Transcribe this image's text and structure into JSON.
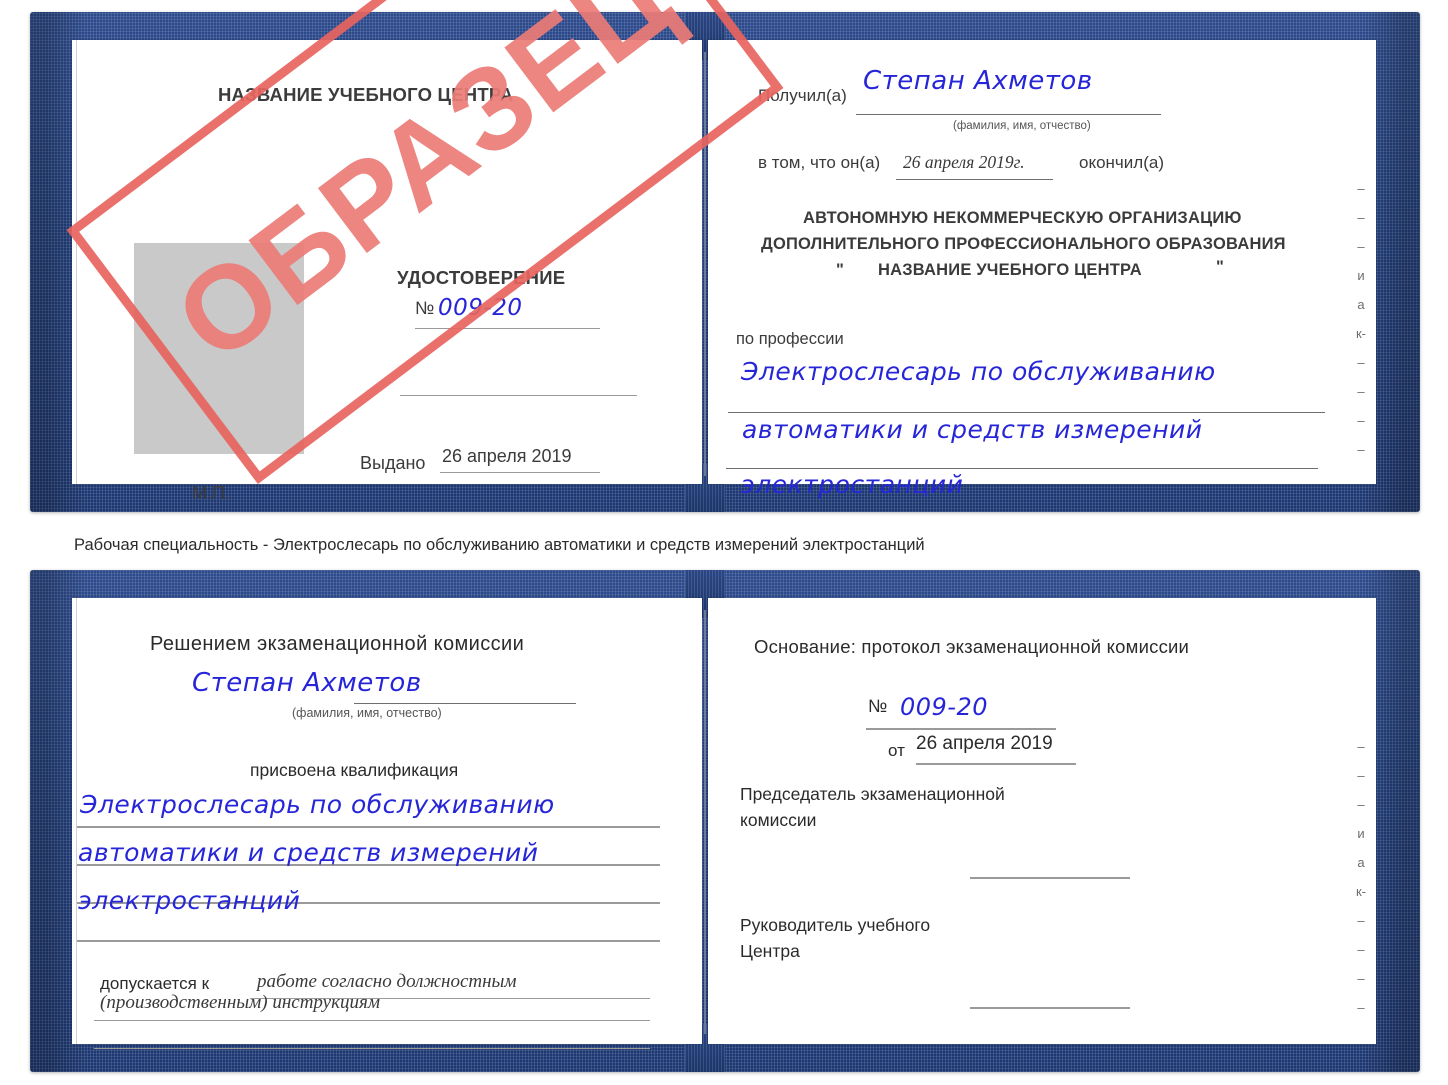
{
  "document": {
    "type": "certificate-scan",
    "caption": "Рабочая специальность - Электрослесарь по обслуживанию автоматики и средств измерений электростанций",
    "watermark": "ОБРАЗЕЦ",
    "colors": {
      "cover_blue": "#23417f",
      "watermark_red": "#e8645f",
      "handwriting_blue": "#2626d8",
      "photo_placeholder_gray": "#c9c9c9"
    }
  },
  "certificate_top": {
    "left_page": {
      "org_title": "НАЗВАНИЕ УЧЕБНОГО ЦЕНТРА",
      "doc_title": "УДОСТОВЕРЕНИЕ",
      "number_label": "№",
      "number_value": "009-20",
      "issued_label": "Выдано",
      "issued_value": "26 апреля 2019",
      "seal_label": "М.П.",
      "photo_placeholder": ""
    },
    "right_page": {
      "received_label": "Получил(а)",
      "received_value": "Степан Ахметов",
      "fio_hint": "(фамилия, имя, отчество)",
      "in_that_label": "в том, что он(а)",
      "completion_date": "26 апреля 2019г.",
      "finished_label": "окончил(а)",
      "org_line1": "АВТОНОМНУЮ НЕКОММЕРЧЕСКУЮ ОРГАНИЗАЦИЮ",
      "org_line2": "ДОПОЛНИТЕЛЬНОГО ПРОФЕССИОНАЛЬНОГО ОБРАЗОВАНИЯ",
      "org_quote_open": "\"",
      "org_line3": "НАЗВАНИЕ УЧЕБНОГО ЦЕНТРА",
      "org_quote_close": "\"",
      "profession_label": "по профессии",
      "profession_line1": "Электрослесарь по обслуживанию",
      "profession_line2": "автоматики и средств измерений",
      "profession_line3": "электростанций",
      "margin_marks": [
        "–",
        "–",
        "–",
        "и",
        "а",
        "к-",
        "–",
        "–",
        "–",
        "–"
      ]
    }
  },
  "certificate_bottom": {
    "left_page": {
      "decision_title": "Решением экзаменационной комиссии",
      "name_value": "Степан Ахметов",
      "fio_hint": "(фамилия, имя, отчество)",
      "qualification_label": "присвоена квалификация",
      "qualification_line1": "Электрослесарь по обслуживанию",
      "qualification_line2": "автоматики и средств измерений",
      "qualification_line3": "электростанций",
      "allowed_label": "допускается к",
      "allowed_value_line1": "работе согласно должностным",
      "allowed_value_line2": "(производственным) инструкциям"
    },
    "right_page": {
      "basis_label": "Основание: протокол экзаменационной комиссии",
      "number_label": "№",
      "number_value": "009-20",
      "date_label": "от",
      "date_value": "26 апреля 2019",
      "chairman_line1": "Председатель экзаменационной",
      "chairman_line2": "комиссии",
      "head_line1": "Руководитель учебного",
      "head_line2": "Центра",
      "margin_marks": [
        "–",
        "–",
        "–",
        "и",
        "а",
        "к-",
        "–",
        "–",
        "–",
        "–"
      ]
    }
  }
}
